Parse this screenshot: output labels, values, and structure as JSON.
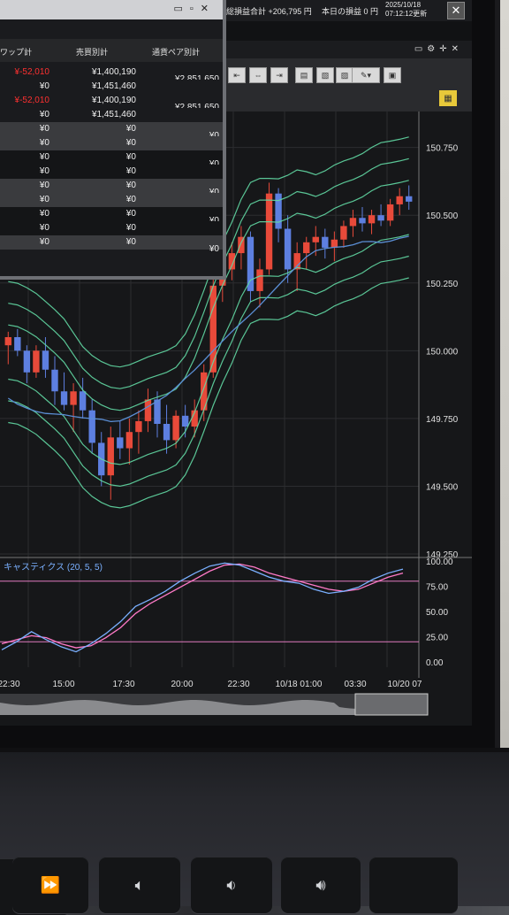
{
  "topbar": {
    "total_pl": "総損益合計 +206,795 円",
    "today_pl": "本日の損益 0 円",
    "date": "2025/10/18",
    "time": "07:12:12更新",
    "close_label": "✕"
  },
  "panel": {
    "headers": [
      "ワップ計",
      "売買別計",
      "通貨ペア別計"
    ],
    "rows": [
      {
        "swap": "¥-52,010",
        "swap_neg": true,
        "buysell": "¥1,400,190",
        "pair": "¥2,851,650"
      },
      {
        "swap": "¥0",
        "buysell": "¥1,451,460",
        "pair": ""
      },
      {
        "swap": "¥-52,010",
        "swap_neg": true,
        "buysell": "¥1,400,190",
        "pair": "¥2,851,650"
      },
      {
        "swap": "¥0",
        "buysell": "¥1,451,460",
        "pair": ""
      },
      {
        "swap": "¥0",
        "buysell": "¥0",
        "pair": "¥0"
      },
      {
        "swap": "¥0",
        "buysell": "¥0",
        "pair": ""
      },
      {
        "swap": "¥0",
        "buysell": "¥0",
        "pair": "¥0"
      },
      {
        "swap": "¥0",
        "buysell": "¥0",
        "pair": ""
      },
      {
        "swap": "¥0",
        "buysell": "¥0",
        "pair": "¥0"
      },
      {
        "swap": "¥0",
        "buysell": "¥0",
        "pair": ""
      },
      {
        "swap": "¥0",
        "buysell": "¥0",
        "pair": "¥0"
      },
      {
        "swap": "¥0",
        "buysell": "¥0",
        "pair": ""
      },
      {
        "swap": "¥0",
        "buysell": "¥0",
        "pair": "¥0"
      }
    ]
  },
  "chart": {
    "price_ticks": [
      "150.750",
      "150.500",
      "150.250",
      "150.000",
      "149.750",
      "149.500",
      "149.250"
    ],
    "stoch_ticks": [
      "100.00",
      "75.00",
      "50.00",
      "25.00",
      "0.00"
    ],
    "stoch_label": "キャスティクス (20, 5, 5)",
    "time_ticks": [
      "22:30",
      "15:00",
      "17:30",
      "20:00",
      "22:30",
      "10/18 01:00",
      "03:30",
      "10/20 07"
    ]
  },
  "chart_data": {
    "type": "candlestick",
    "y_range": [
      149.25,
      150.85
    ],
    "candles": [
      [
        150.02,
        150.07,
        149.95,
        150.05
      ],
      [
        150.05,
        150.08,
        149.98,
        150.0
      ],
      [
        150.0,
        150.02,
        149.88,
        149.92
      ],
      [
        149.92,
        150.02,
        149.9,
        150.0
      ],
      [
        150.0,
        150.05,
        149.9,
        149.93
      ],
      [
        149.93,
        149.98,
        149.8,
        149.85
      ],
      [
        149.85,
        149.92,
        149.78,
        149.8
      ],
      [
        149.8,
        149.88,
        149.7,
        149.85
      ],
      [
        149.85,
        149.9,
        149.75,
        149.78
      ],
      [
        149.78,
        149.82,
        149.62,
        149.66
      ],
      [
        149.66,
        149.7,
        149.5,
        149.54
      ],
      [
        149.54,
        149.72,
        149.45,
        149.68
      ],
      [
        149.68,
        149.74,
        149.6,
        149.64
      ],
      [
        149.64,
        149.75,
        149.58,
        149.7
      ],
      [
        149.7,
        149.78,
        149.62,
        149.74
      ],
      [
        149.74,
        149.86,
        149.7,
        149.82
      ],
      [
        149.82,
        149.85,
        149.68,
        149.73
      ],
      [
        149.73,
        149.8,
        149.62,
        149.67
      ],
      [
        149.67,
        149.78,
        149.64,
        149.76
      ],
      [
        149.76,
        149.8,
        149.68,
        149.72
      ],
      [
        149.72,
        149.82,
        149.68,
        149.78
      ],
      [
        149.78,
        149.95,
        149.74,
        149.92
      ],
      [
        149.92,
        150.28,
        149.9,
        150.24
      ],
      [
        150.24,
        150.34,
        150.18,
        150.3
      ],
      [
        150.3,
        150.4,
        150.26,
        150.36
      ],
      [
        150.36,
        150.46,
        150.3,
        150.42
      ],
      [
        150.42,
        150.44,
        150.18,
        150.22
      ],
      [
        150.22,
        150.34,
        150.16,
        150.3
      ],
      [
        150.3,
        150.62,
        150.28,
        150.58
      ],
      [
        150.58,
        150.6,
        150.4,
        150.45
      ],
      [
        150.45,
        150.5,
        150.25,
        150.3
      ],
      [
        150.3,
        150.4,
        150.22,
        150.36
      ],
      [
        150.36,
        150.42,
        150.3,
        150.4
      ],
      [
        150.4,
        150.46,
        150.35,
        150.42
      ],
      [
        150.42,
        150.45,
        150.34,
        150.38
      ],
      [
        150.38,
        150.44,
        150.33,
        150.41
      ],
      [
        150.41,
        150.48,
        150.38,
        150.46
      ],
      [
        150.46,
        150.52,
        150.42,
        150.49
      ],
      [
        150.49,
        150.53,
        150.44,
        150.47
      ],
      [
        150.47,
        150.52,
        150.43,
        150.5
      ],
      [
        150.5,
        150.54,
        150.46,
        150.48
      ],
      [
        150.48,
        150.56,
        150.46,
        150.54
      ],
      [
        150.54,
        150.6,
        150.5,
        150.57
      ],
      [
        150.57,
        150.61,
        150.52,
        150.55
      ]
    ],
    "stochastic_k": [
      12,
      20,
      30,
      22,
      15,
      10,
      18,
      28,
      40,
      55,
      62,
      70,
      80,
      88,
      95,
      98,
      96,
      90,
      84,
      80,
      78,
      72,
      68,
      70,
      74,
      82,
      88,
      92
    ],
    "stochastic_d": [
      18,
      22,
      26,
      24,
      18,
      14,
      16,
      24,
      34,
      48,
      58,
      66,
      74,
      82,
      90,
      96,
      97,
      94,
      88,
      84,
      80,
      76,
      72,
      70,
      72,
      78,
      84,
      88
    ],
    "stoch_levels": [
      80,
      20
    ],
    "colors": {
      "up": "#e84a3a",
      "down": "#5d7fe0",
      "bands": "#62d9a4",
      "ma": "#5b8fd6",
      "k": "#7ab0ff",
      "d": "#ff7ac8"
    }
  }
}
